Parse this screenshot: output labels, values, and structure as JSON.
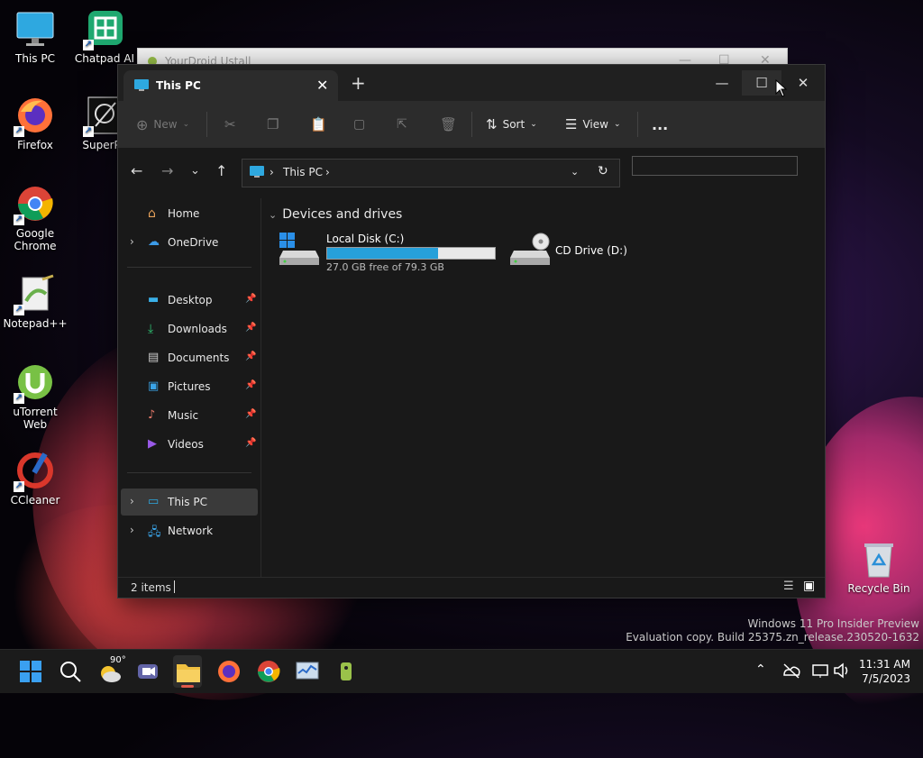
{
  "desktop": {
    "icons": [
      {
        "label": "This PC"
      },
      {
        "label": "Chatpad AI"
      },
      {
        "label": "Firefox"
      },
      {
        "label": "SuperPa"
      },
      {
        "label": "Google Chrome"
      },
      {
        "label": "Notepad++"
      },
      {
        "label": "uTorrent Web"
      },
      {
        "label": "CCleaner"
      },
      {
        "label": "Recycle Bin"
      }
    ],
    "watermark_line1": "Windows 11 Pro Insider Preview",
    "watermark_line2": "Evaluation copy. Build 25375.zn_release.230520-1632"
  },
  "background_window": {
    "title": "YourDroid Ustall"
  },
  "explorer": {
    "tab_title": "This PC",
    "toolbar": {
      "new": "New",
      "sort": "Sort",
      "view": "View",
      "more": "..."
    },
    "address": {
      "crumb": "This PC"
    },
    "search": {
      "placeholder": ""
    },
    "nav": [
      {
        "label": "Home"
      },
      {
        "label": "OneDrive"
      },
      {
        "label": "Desktop"
      },
      {
        "label": "Downloads"
      },
      {
        "label": "Documents"
      },
      {
        "label": "Pictures"
      },
      {
        "label": "Music"
      },
      {
        "label": "Videos"
      },
      {
        "label": "This PC"
      },
      {
        "label": "Network"
      }
    ],
    "section_title": "Devices and drives",
    "drives": [
      {
        "name": "Local Disk (C:)",
        "free": "27.0 GB free of 79.3 GB",
        "used_fraction": 0.66
      },
      {
        "name": "CD Drive (D:)"
      }
    ],
    "status": "2 items"
  },
  "taskbar": {
    "weather_temp": "90°",
    "time": "11:31 AM",
    "date": "7/5/2023"
  },
  "colors": {
    "accent": "#26a0da",
    "window_bg": "#191919"
  }
}
